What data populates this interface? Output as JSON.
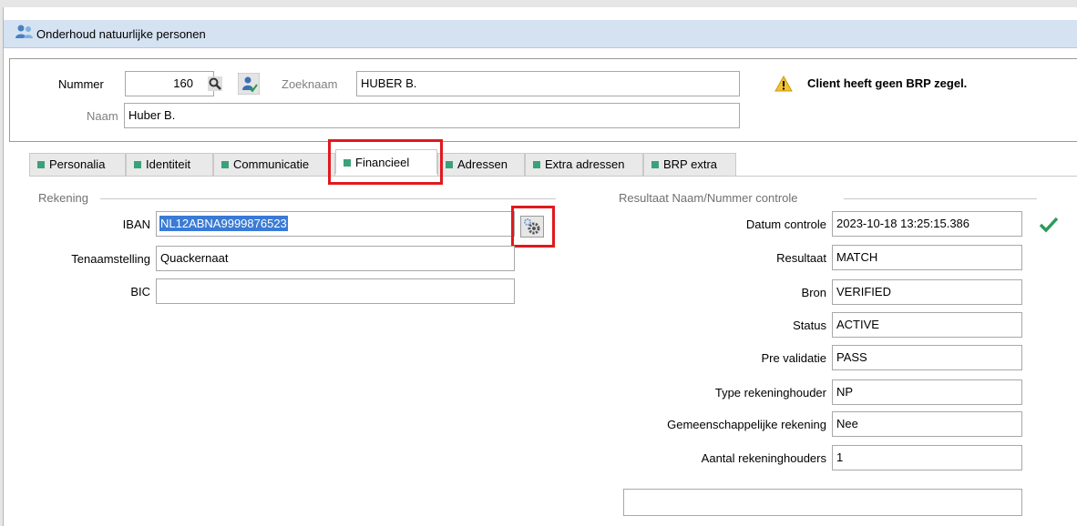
{
  "window": {
    "title": "Onderhoud natuurlijke personen"
  },
  "header": {
    "nummer_label": "Nummer",
    "nummer_value": "160",
    "zoeknaam_label": "Zoeknaam",
    "zoeknaam_value": "HUBER B.",
    "naam_label": "Naam",
    "naam_value": "Huber B.",
    "warning_text": "Client heeft geen BRP zegel."
  },
  "tabs": [
    {
      "label": "Personalia"
    },
    {
      "label": "Identiteit"
    },
    {
      "label": "Communicatie"
    },
    {
      "label": "Financieel"
    },
    {
      "label": "Adressen"
    },
    {
      "label": "Extra adressen"
    },
    {
      "label": "BRP extra"
    }
  ],
  "rekening": {
    "group_title": "Rekening",
    "iban_label": "IBAN",
    "iban_value": "NL12ABNA9999876523",
    "tenaamstelling_label": "Tenaamstelling",
    "tenaamstelling_value": "Quackernaat",
    "bic_label": "BIC",
    "bic_value": ""
  },
  "controle": {
    "group_title": "Resultaat Naam/Nummer controle",
    "rows": [
      {
        "label": "Datum controle",
        "value": "2023-10-18 13:25:15.386"
      },
      {
        "label": "Resultaat",
        "value": "MATCH"
      },
      {
        "label": "Bron",
        "value": "VERIFIED"
      },
      {
        "label": "Status",
        "value": "ACTIVE"
      },
      {
        "label": "Pre validatie",
        "value": "PASS"
      },
      {
        "label": "Type rekeninghouder",
        "value": "NP"
      },
      {
        "label": "Gemeenschappelijke rekening",
        "value": "Nee"
      },
      {
        "label": "Aantal rekeninghouders",
        "value": "1"
      }
    ],
    "bottom_value": ""
  },
  "colors": {
    "accent": "#3aa27a",
    "highlight": "#e0191e",
    "selection": "#3a7bd5"
  }
}
